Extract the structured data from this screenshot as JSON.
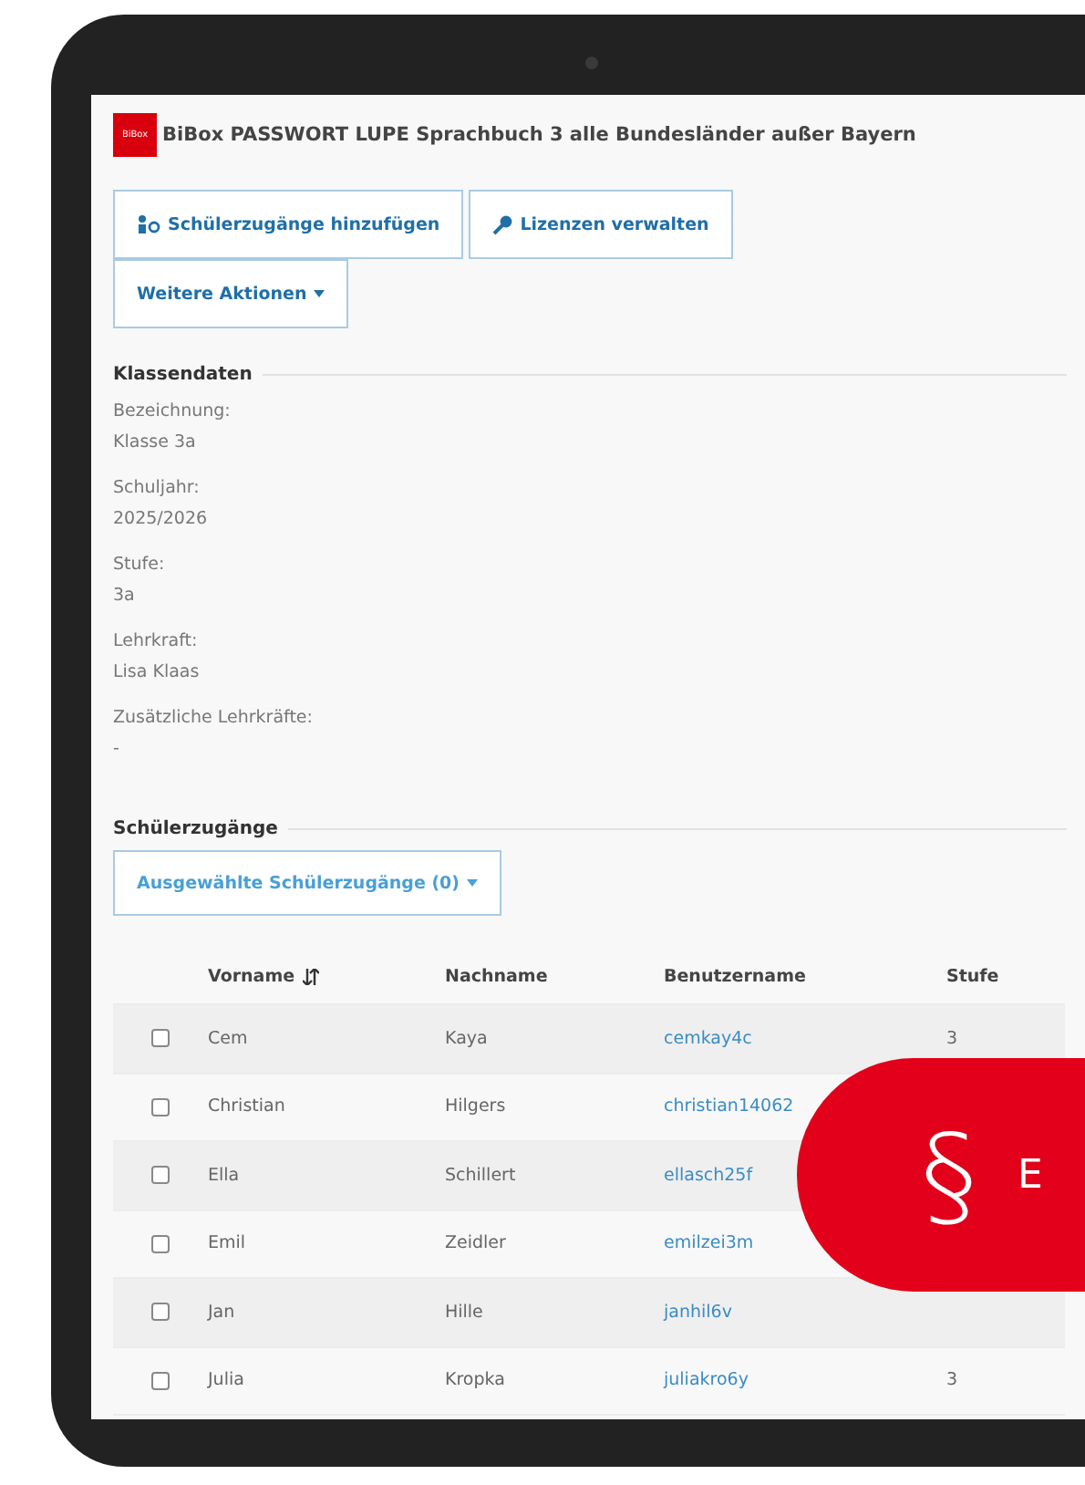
{
  "header": {
    "logo": "BiBox",
    "title": "BiBox PASSWORT LUPE Sprachbuch 3 alle Bundesländer außer Bayern"
  },
  "actions": [
    {
      "kind": "person",
      "label": "Schülerzugänge hinzufügen"
    },
    {
      "kind": "key",
      "label": "Lizenzen verwalten"
    },
    {
      "kind": "menu",
      "label": "Weitere Aktionen"
    }
  ],
  "class_data": {
    "heading": "Klassendaten",
    "fields": [
      {
        "label": "Bezeichnung:",
        "value": "Klasse 3a"
      },
      {
        "label": "Schuljahr:",
        "value": "2025/2026"
      },
      {
        "label": "Stufe:",
        "value": "3a"
      },
      {
        "label": "Lehrkraft:",
        "value": "Lisa Klaas"
      },
      {
        "label": "Zusätzliche Lehrkräfte:",
        "value": "-"
      }
    ]
  },
  "students": {
    "heading": "Schülerzugänge",
    "selection_button": "Ausgewählte Schülerzugänge (0)",
    "columns": [
      {
        "label": "Vorname",
        "sorted": true
      },
      {
        "label": "Nachname",
        "sorted": false
      },
      {
        "label": "Benutzername",
        "sorted": false
      },
      {
        "label": "Stufe",
        "sorted": false
      }
    ],
    "rows": [
      {
        "checked": false,
        "first": "Cem",
        "last": "Kaya",
        "user": "cemkay4c",
        "level": "3"
      },
      {
        "checked": false,
        "first": "Christian",
        "last": "Hilgers",
        "user": "christian14062"
      },
      {
        "checked": false,
        "first": "Ella",
        "last": "Schillert",
        "user": "ellasch25f"
      },
      {
        "checked": false,
        "first": "Emil",
        "last": "Zeidler",
        "user": "emilzei3m"
      },
      {
        "checked": false,
        "first": "Jan",
        "last": "Hille",
        "user": "janhil6v"
      },
      {
        "checked": false,
        "first": "Julia",
        "last": "Kropka",
        "user": "juliakro6y",
        "level": "3"
      }
    ]
  },
  "badge": {
    "symbol": "§",
    "text": "E"
  }
}
